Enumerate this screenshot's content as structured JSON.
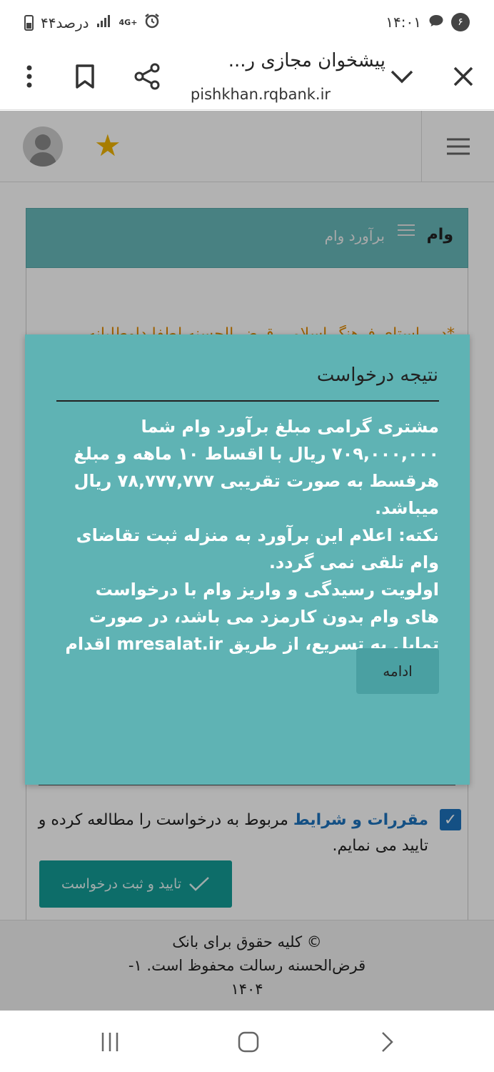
{
  "status_bar": {
    "time": "۱۴:۰۱",
    "notification_count": "۶",
    "battery": "۴۴درصد",
    "network": "4G+"
  },
  "browser": {
    "title": "پیشخوان مجازی ر...",
    "url": "pishkhan.rqbank.ir"
  },
  "card": {
    "header_title": "وام",
    "header_subtitle": "برآورد وام",
    "note": "*در راستای فرهنگ اسلامی قرض الحسنه لطفا داوطلبانه"
  },
  "modal": {
    "title": "نتیجه درخواست",
    "message_1": "مشتری گرامی مبلغ برآورد وام شما ۷۰۹,۰۰۰,۰۰۰ ریال با اقساط ۱۰ ماهه و مبلغ هرقسط به صورت تقریبی ۷۸,۷۷۷,۷۷۷ ریال میباشد.",
    "message_2": "نکته: اعلام این برآورد به منزله ثبت تقاضای وام تلقی نمی گردد.",
    "message_3": "اولویت رسیدگی و واریز وام با درخواست های وام بدون کارمزد می باشد، در صورت تمایل به تسریع، از طریق mresalat.ir اقدام نمائید.",
    "button_label": "ادامه"
  },
  "terms": {
    "link_text": "مقررات و شرایط",
    "text": "مربوط به درخواست را مطالعه کرده و تایید می نمایم."
  },
  "submit_label": "تایید و ثبت درخواست",
  "footer": {
    "line_1": "© کلیه حقوق برای بانک",
    "line_2": "قرض‌الحسنه رسالت محفوظ است. ۱-",
    "line_3": "۱۴۰۴"
  },
  "colors": {
    "modal_bg": "#5fb3b4",
    "header_bg": "#67b9bb",
    "submit_bg": "#139c97",
    "link": "#1e73be",
    "star": "#f0b400"
  }
}
